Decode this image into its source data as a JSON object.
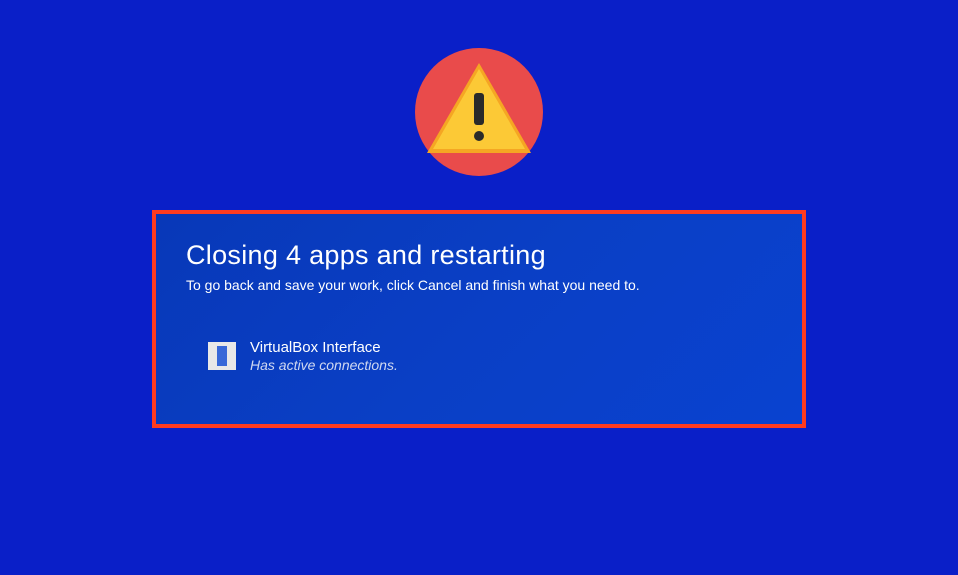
{
  "warning": {
    "icon_name": "warning-triangle-icon"
  },
  "dialog": {
    "title": "Closing 4 apps and restarting",
    "subtitle": "To go back and save your work, click Cancel and finish what you need to.",
    "apps": [
      {
        "name": "VirtualBox Interface",
        "status": "Has active connections."
      }
    ]
  }
}
